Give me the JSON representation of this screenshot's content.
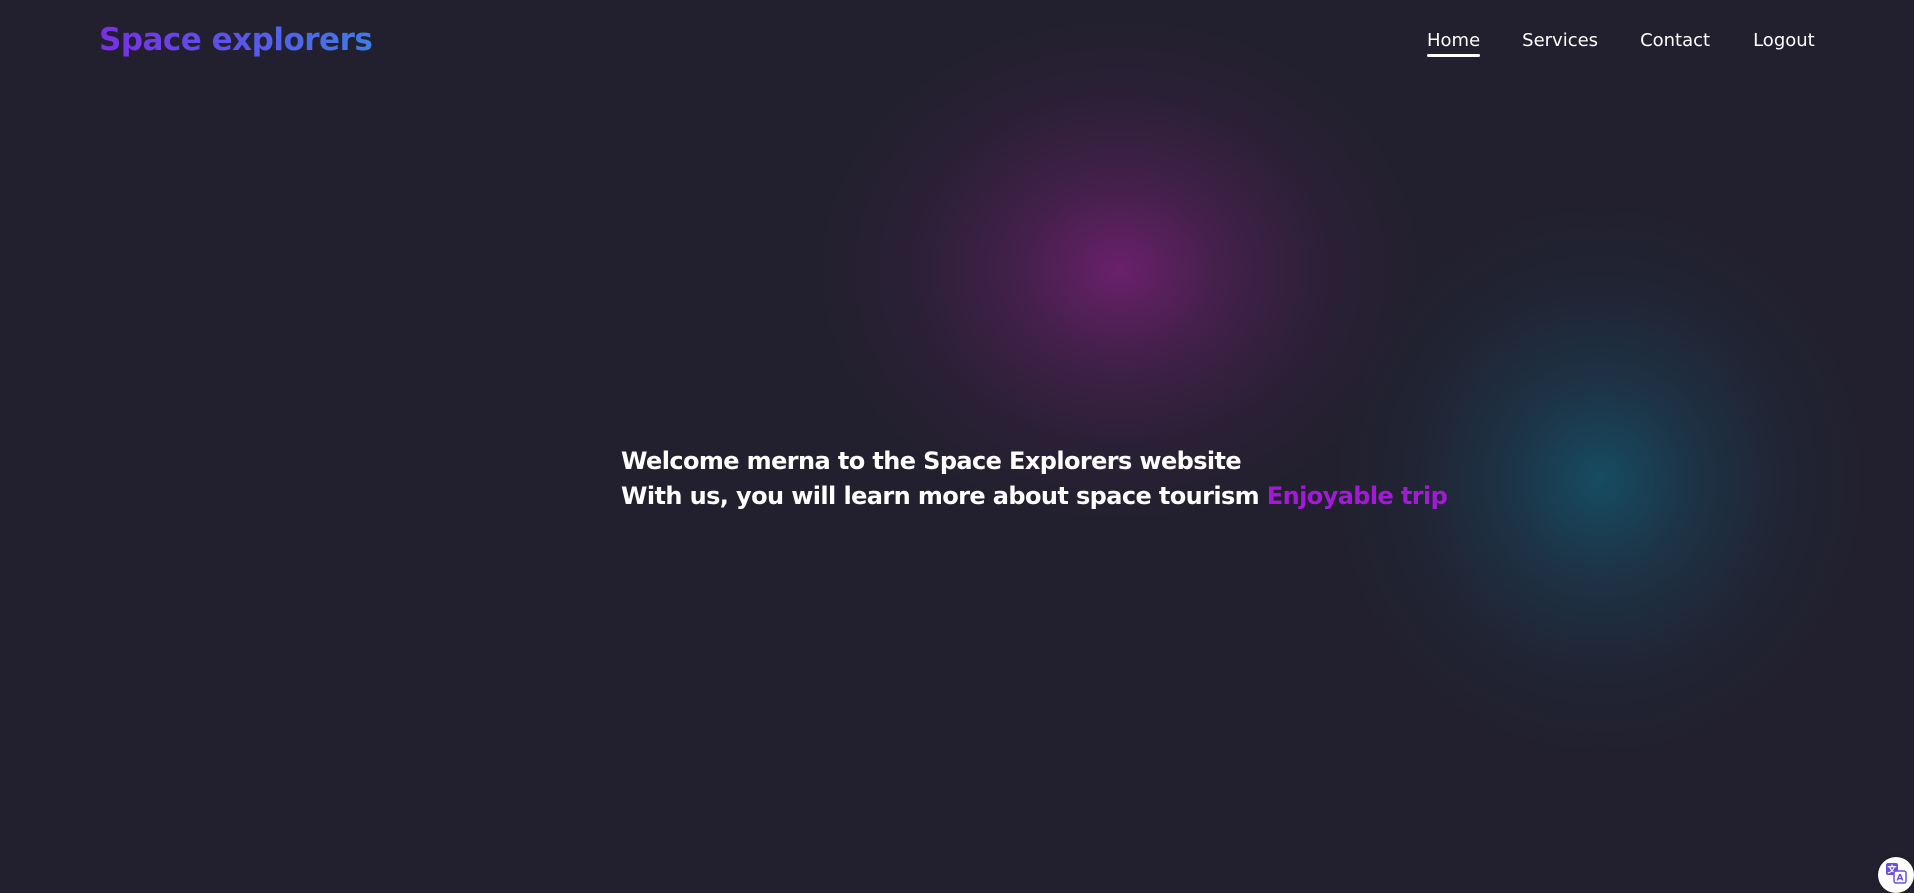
{
  "brand": {
    "title": "Space explorers"
  },
  "nav": {
    "items": [
      {
        "label": "Home",
        "active": true
      },
      {
        "label": "Services",
        "active": false
      },
      {
        "label": "Contact",
        "active": false
      },
      {
        "label": "Logout",
        "active": false
      }
    ]
  },
  "hero": {
    "line1": "Welcome merna to the Space Explorers website",
    "line2": "With us, you will learn more about space tourism",
    "highlight": "Enjoyable trip"
  },
  "colors": {
    "background": "#22202e",
    "brand_gradient_start": "#7b2ee6",
    "brand_gradient_end": "#3f7de6",
    "accent": "#a31ad6",
    "glow_purple": "#6e206e",
    "glow_teal": "#164e64"
  },
  "icons": {
    "translate": "translate-icon"
  }
}
